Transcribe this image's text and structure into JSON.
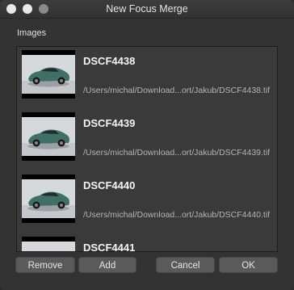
{
  "window": {
    "title": "New Focus Merge"
  },
  "images_section": {
    "label": "Images",
    "items": [
      {
        "name": "DSCF4438",
        "path": "/Users/michal/Download...ort/Jakub/DSCF4438.tif"
      },
      {
        "name": "DSCF4439",
        "path": "/Users/michal/Download...ort/Jakub/DSCF4439.tif"
      },
      {
        "name": "DSCF4440",
        "path": "/Users/michal/Download...ort/Jakub/DSCF4440.tif"
      },
      {
        "name": "DSCF4441",
        "path": ""
      }
    ]
  },
  "buttons": {
    "remove": "Remove",
    "add": "Add",
    "cancel": "Cancel",
    "ok": "OK"
  },
  "colors": {
    "window_bg": "#333333",
    "list_bg": "#3a3a3a",
    "button_bg": "#5a5a5a",
    "car_body": "#3f6f66"
  }
}
